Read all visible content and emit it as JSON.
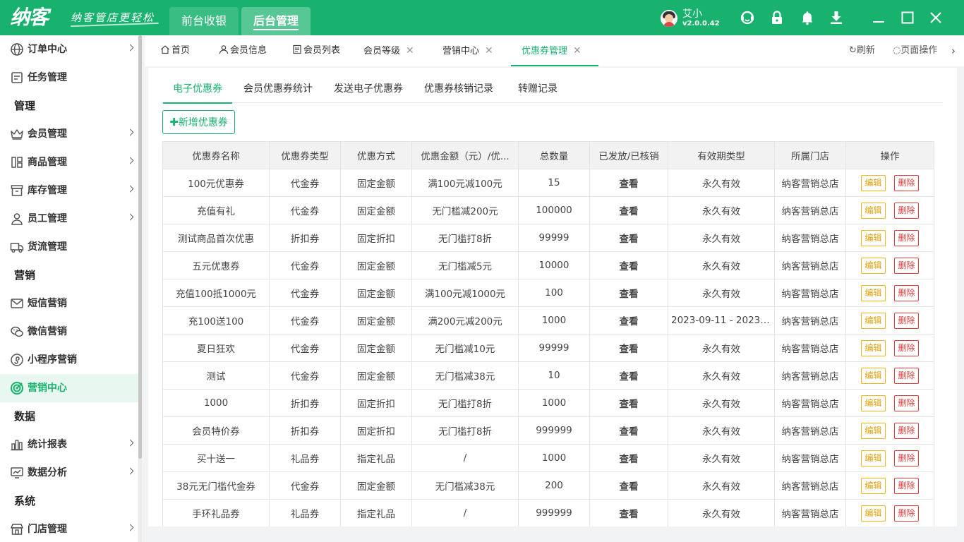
{
  "app": {
    "logo": "纳客",
    "slogan": "纳客管店更轻松",
    "module_tabs": [
      "前台收银",
      "后台管理"
    ],
    "active_module": "后台管理",
    "user": {
      "name": "艾小",
      "version": "v2.0.0.42"
    },
    "brand_color": "#18b26e",
    "toolbar_icons": [
      "support-icon",
      "lock-icon",
      "bell-icon",
      "download-icon",
      "minimize-icon",
      "maximize-icon",
      "close-icon"
    ]
  },
  "sidebar": {
    "items": [
      {
        "label": "订单中心",
        "icon": "globe-icon",
        "arrow": true
      },
      {
        "label": "任务管理",
        "icon": "task-icon",
        "arrow": false
      },
      {
        "group": "管理"
      },
      {
        "label": "会员管理",
        "icon": "crown-icon",
        "arrow": true
      },
      {
        "label": "商品管理",
        "icon": "goods-icon",
        "arrow": true
      },
      {
        "label": "库存管理",
        "icon": "inventory-icon",
        "arrow": true
      },
      {
        "label": "员工管理",
        "icon": "person-icon",
        "arrow": true
      },
      {
        "label": "货流管理",
        "icon": "truck-icon",
        "arrow": false
      },
      {
        "group": "营销"
      },
      {
        "label": "短信营销",
        "icon": "mail-icon",
        "arrow": false
      },
      {
        "label": "微信营销",
        "icon": "wechat-icon",
        "arrow": false
      },
      {
        "label": "小程序营销",
        "icon": "miniapp-icon",
        "arrow": false
      },
      {
        "label": "营销中心",
        "icon": "target-icon",
        "arrow": false,
        "active": true
      },
      {
        "group": "数据"
      },
      {
        "label": "统计报表",
        "icon": "bar-chart-icon",
        "arrow": true
      },
      {
        "label": "数据分析",
        "icon": "analysis-icon",
        "arrow": true
      },
      {
        "group": "系统"
      },
      {
        "label": "门店管理",
        "icon": "store-icon",
        "arrow": true
      }
    ]
  },
  "page_tabs": {
    "tabs": [
      {
        "label": "首页",
        "icon": "home-icon",
        "closable": false
      },
      {
        "label": "会员信息",
        "icon": "member-icon",
        "closable": false
      },
      {
        "label": "会员列表",
        "icon": "list-icon",
        "closable": false
      },
      {
        "label": "会员等级",
        "closable": true
      },
      {
        "label": "营销中心",
        "closable": true
      },
      {
        "label": "优惠券管理",
        "closable": true,
        "active": true
      }
    ],
    "refresh": "刷新",
    "page_ops": "页面操作"
  },
  "subtabs": {
    "items": [
      "电子优惠券",
      "会员优惠券统计",
      "发送电子优惠券",
      "优惠券核销记录",
      "转赠记录"
    ],
    "active": "电子优惠券"
  },
  "add_button": "新增优惠券",
  "table": {
    "columns": [
      "优惠券名称",
      "优惠券类型",
      "优惠方式",
      "优惠金额（元）/优...",
      "总数量",
      "已发放/已核销",
      "有效期类型",
      "所属门店",
      "操作"
    ],
    "view_label": "查看",
    "edit_label": "编辑",
    "delete_label": "删除",
    "rows": [
      [
        "100元优惠券",
        "代金券",
        "固定金额",
        "满100元减100元",
        "15",
        "永久有效",
        "纳客营销总店"
      ],
      [
        "充值有礼",
        "代金券",
        "固定金额",
        "无门槛减200元",
        "100000",
        "永久有效",
        "纳客营销总店"
      ],
      [
        "测试商品首次优惠",
        "折扣券",
        "固定折扣",
        "无门槛打8折",
        "99999",
        "永久有效",
        "纳客营销总店"
      ],
      [
        "五元优惠券",
        "代金券",
        "固定金额",
        "无门槛减5元",
        "10000",
        "永久有效",
        "纳客营销总店"
      ],
      [
        "充值100抵1000元",
        "代金券",
        "固定金额",
        "满100元减1000元",
        "100",
        "永久有效",
        "纳客营销总店"
      ],
      [
        "充100送100",
        "代金券",
        "固定金额",
        "满200元减200元",
        "1000",
        "2023-09-11 - 2023-...",
        "纳客营销总店"
      ],
      [
        "夏日狂欢",
        "代金券",
        "固定金额",
        "无门槛减10元",
        "99999",
        "永久有效",
        "纳客营销总店"
      ],
      [
        "测试",
        "代金券",
        "固定金额",
        "无门槛减38元",
        "10",
        "永久有效",
        "纳客营销总店"
      ],
      [
        "1000",
        "折扣券",
        "固定折扣",
        "无门槛打8折",
        "1000",
        "永久有效",
        "纳客营销总店"
      ],
      [
        "会员特价券",
        "折扣券",
        "固定折扣",
        "无门槛打8折",
        "999999",
        "永久有效",
        "纳客营销总店"
      ],
      [
        "买十送一",
        "礼品券",
        "指定礼品",
        "/",
        "1000",
        "永久有效",
        "纳客营销总店"
      ],
      [
        "38元无门槛代金券",
        "代金券",
        "固定金额",
        "无门槛减38元",
        "200",
        "永久有效",
        "纳客营销总店"
      ],
      [
        "手环礼品券",
        "礼品券",
        "指定礼品",
        "/",
        "999999",
        "永久有效",
        "纳客营销总店"
      ]
    ]
  }
}
